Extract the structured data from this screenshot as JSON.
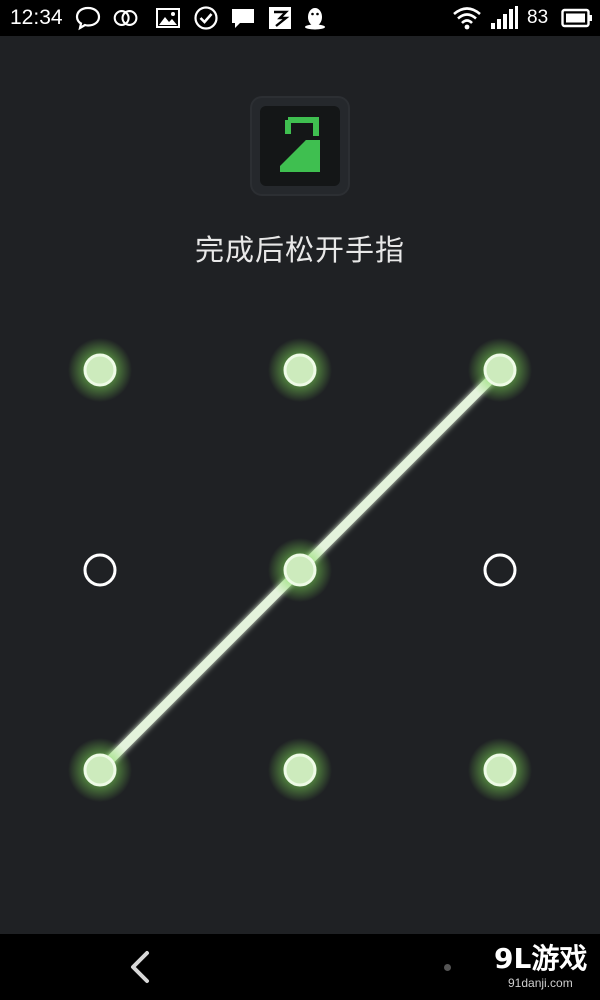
{
  "status_bar": {
    "time": "12:34",
    "battery": "83",
    "icons": [
      "chat-bubble-icon",
      "double-ring-icon",
      "image-icon",
      "check-circle-icon",
      "message-icon",
      "app-badge-icon",
      "penguin-icon",
      "wifi-icon",
      "signal-icon",
      "battery-icon"
    ]
  },
  "app": {
    "logo_icon": "lock-app-icon",
    "accent_color": "#3fbf50"
  },
  "prompt": "完成后松开手指",
  "pattern": {
    "grid": 3,
    "selected_sequence": [
      1,
      2,
      3,
      5,
      7,
      8,
      9
    ],
    "unselected_dots": [
      4,
      6
    ],
    "line_color": "#e4f3dc",
    "glow_color": "#7ed957"
  },
  "nav_bar": {
    "back_icon": "chevron-left-icon",
    "watermark": {
      "brand": "9L游戏",
      "site": "91danji.com"
    }
  }
}
